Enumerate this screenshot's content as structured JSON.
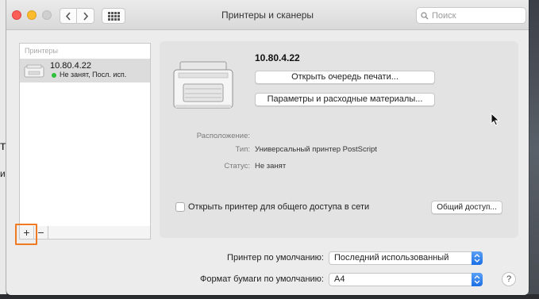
{
  "window": {
    "title": "Принтеры и сканеры",
    "search_placeholder": "Поиск"
  },
  "backdrop": {
    "left_glyph_1": "т",
    "left_glyph_2": "и"
  },
  "printer_list": {
    "header": "Принтеры",
    "items": [
      {
        "name": "10.80.4.22",
        "status": "Не занят, Посл. исп.",
        "status_color": "#2fbf3a"
      }
    ],
    "add_label": "+",
    "remove_label": "−",
    "highlight_color": "#f07a21"
  },
  "details": {
    "printer_name": "10.80.4.22",
    "open_queue_label": "Открыть очередь печати...",
    "options_label": "Параметры и расходные материалы...",
    "location_label": "Расположение:",
    "location_value": "",
    "type_label": "Тип:",
    "type_value": "Универсальный принтер PostScript",
    "status_label": "Статус:",
    "status_value": "Не занят",
    "share_label": "Открыть принтер для общего доступа в сети",
    "share_checked": false,
    "share_button_label": "Общий доступ..."
  },
  "defaults": {
    "default_printer_label": "Принтер по умолчанию:",
    "default_printer_value": "Последний использованный",
    "paper_label": "Формат бумаги по умолчанию:",
    "paper_value": "A4",
    "help_label": "?"
  },
  "colors": {
    "accent": "#1b6fe6",
    "close": "#fc5f57",
    "minimize": "#fdbc2e"
  }
}
